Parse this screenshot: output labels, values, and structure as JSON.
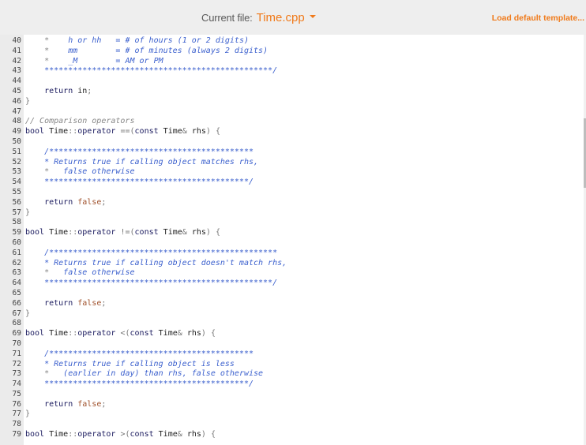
{
  "header": {
    "current_file_label": "Current file:",
    "current_file_name": "Time.cpp",
    "load_template_label": "Load default template...",
    "accent_color": "#f07a1a"
  },
  "editor": {
    "lines": [
      {
        "n": "40",
        "tokens": [
          [
            "doc",
            "    "
          ],
          [
            "star",
            "*"
          ],
          [
            "doc",
            "    h or hh   = # of hours (1 or 2 digits)"
          ]
        ]
      },
      {
        "n": "41",
        "tokens": [
          [
            "doc",
            "    "
          ],
          [
            "star",
            "*"
          ],
          [
            "doc",
            "    mm        = # of minutes (always 2 digits)"
          ]
        ]
      },
      {
        "n": "42",
        "tokens": [
          [
            "doc",
            "    "
          ],
          [
            "star",
            "*"
          ],
          [
            "doc",
            "    _M        = AM or PM"
          ]
        ]
      },
      {
        "n": "43",
        "tokens": [
          [
            "doc",
            "    ************************************************/"
          ]
        ]
      },
      {
        "n": "44",
        "tokens": []
      },
      {
        "n": "45",
        "tokens": [
          [
            "sp",
            "    "
          ],
          [
            "kw",
            "return"
          ],
          [
            "sp",
            " "
          ],
          [
            "id",
            "in"
          ],
          [
            "pn",
            ";"
          ]
        ]
      },
      {
        "n": "46",
        "tokens": [
          [
            "pn",
            "}"
          ]
        ]
      },
      {
        "n": "47",
        "tokens": []
      },
      {
        "n": "48",
        "tokens": [
          [
            "cm",
            "// Comparison operators"
          ]
        ]
      },
      {
        "n": "49",
        "tokens": [
          [
            "ty",
            "bool"
          ],
          [
            "sp",
            " "
          ],
          [
            "id",
            "Time"
          ],
          [
            "pn",
            "::"
          ],
          [
            "kw",
            "operator"
          ],
          [
            "sp",
            " "
          ],
          [
            "pn",
            "==("
          ],
          [
            "kw",
            "const"
          ],
          [
            "sp",
            " "
          ],
          [
            "id",
            "Time"
          ],
          [
            "pn",
            "&"
          ],
          [
            "sp",
            " "
          ],
          [
            "id",
            "rhs"
          ],
          [
            "pn",
            ")"
          ],
          [
            "sp",
            " "
          ],
          [
            "pn",
            "{"
          ]
        ]
      },
      {
        "n": "50",
        "tokens": []
      },
      {
        "n": "51",
        "tokens": [
          [
            "doc",
            "    /*******************************************"
          ]
        ]
      },
      {
        "n": "52",
        "tokens": [
          [
            "doc",
            "    * Returns true if calling object matches rhs,"
          ]
        ]
      },
      {
        "n": "53",
        "tokens": [
          [
            "doc",
            "    "
          ],
          [
            "star",
            "*"
          ],
          [
            "doc",
            "   false otherwise"
          ]
        ]
      },
      {
        "n": "54",
        "tokens": [
          [
            "doc",
            "    *******************************************/"
          ]
        ]
      },
      {
        "n": "55",
        "tokens": []
      },
      {
        "n": "56",
        "tokens": [
          [
            "sp",
            "    "
          ],
          [
            "kw",
            "return"
          ],
          [
            "sp",
            " "
          ],
          [
            "lit",
            "false"
          ],
          [
            "pn",
            ";"
          ]
        ]
      },
      {
        "n": "57",
        "tokens": [
          [
            "pn",
            "}"
          ]
        ]
      },
      {
        "n": "58",
        "tokens": []
      },
      {
        "n": "59",
        "tokens": [
          [
            "ty",
            "bool"
          ],
          [
            "sp",
            " "
          ],
          [
            "id",
            "Time"
          ],
          [
            "pn",
            "::"
          ],
          [
            "kw",
            "operator"
          ],
          [
            "sp",
            " "
          ],
          [
            "pn",
            "!=("
          ],
          [
            "kw",
            "const"
          ],
          [
            "sp",
            " "
          ],
          [
            "id",
            "Time"
          ],
          [
            "pn",
            "&"
          ],
          [
            "sp",
            " "
          ],
          [
            "id",
            "rhs"
          ],
          [
            "pn",
            ")"
          ],
          [
            "sp",
            " "
          ],
          [
            "pn",
            "{"
          ]
        ]
      },
      {
        "n": "60",
        "tokens": []
      },
      {
        "n": "61",
        "tokens": [
          [
            "doc",
            "    /************************************************"
          ]
        ]
      },
      {
        "n": "62",
        "tokens": [
          [
            "doc",
            "    * Returns true if calling object doesn't match rhs,"
          ]
        ]
      },
      {
        "n": "63",
        "tokens": [
          [
            "doc",
            "    "
          ],
          [
            "star",
            "*"
          ],
          [
            "doc",
            "   false otherwise"
          ]
        ]
      },
      {
        "n": "64",
        "tokens": [
          [
            "doc",
            "    ************************************************/"
          ]
        ]
      },
      {
        "n": "65",
        "tokens": []
      },
      {
        "n": "66",
        "tokens": [
          [
            "sp",
            "    "
          ],
          [
            "kw",
            "return"
          ],
          [
            "sp",
            " "
          ],
          [
            "lit",
            "false"
          ],
          [
            "pn",
            ";"
          ]
        ]
      },
      {
        "n": "67",
        "tokens": [
          [
            "pn",
            "}"
          ]
        ]
      },
      {
        "n": "68",
        "tokens": []
      },
      {
        "n": "69",
        "tokens": [
          [
            "ty",
            "bool"
          ],
          [
            "sp",
            " "
          ],
          [
            "id",
            "Time"
          ],
          [
            "pn",
            "::"
          ],
          [
            "kw",
            "operator"
          ],
          [
            "sp",
            " "
          ],
          [
            "pn",
            "<("
          ],
          [
            "kw",
            "const"
          ],
          [
            "sp",
            " "
          ],
          [
            "id",
            "Time"
          ],
          [
            "pn",
            "&"
          ],
          [
            "sp",
            " "
          ],
          [
            "id",
            "rhs"
          ],
          [
            "pn",
            ")"
          ],
          [
            "sp",
            " "
          ],
          [
            "pn",
            "{"
          ]
        ]
      },
      {
        "n": "70",
        "tokens": []
      },
      {
        "n": "71",
        "tokens": [
          [
            "doc",
            "    /*******************************************"
          ]
        ]
      },
      {
        "n": "72",
        "tokens": [
          [
            "doc",
            "    * Returns true if calling object is less"
          ]
        ]
      },
      {
        "n": "73",
        "tokens": [
          [
            "doc",
            "    "
          ],
          [
            "star",
            "*"
          ],
          [
            "doc",
            "   (earlier in day) than rhs, false otherwise"
          ]
        ]
      },
      {
        "n": "74",
        "tokens": [
          [
            "doc",
            "    *******************************************/"
          ]
        ]
      },
      {
        "n": "75",
        "tokens": []
      },
      {
        "n": "76",
        "tokens": [
          [
            "sp",
            "    "
          ],
          [
            "kw",
            "return"
          ],
          [
            "sp",
            " "
          ],
          [
            "lit",
            "false"
          ],
          [
            "pn",
            ";"
          ]
        ]
      },
      {
        "n": "77",
        "tokens": [
          [
            "pn",
            "}"
          ]
        ]
      },
      {
        "n": "78",
        "tokens": []
      },
      {
        "n": "79",
        "tokens": [
          [
            "ty",
            "bool"
          ],
          [
            "sp",
            " "
          ],
          [
            "id",
            "Time"
          ],
          [
            "pn",
            "::"
          ],
          [
            "kw",
            "operator"
          ],
          [
            "sp",
            " "
          ],
          [
            "pn",
            ">("
          ],
          [
            "kw",
            "const"
          ],
          [
            "sp",
            " "
          ],
          [
            "id",
            "Time"
          ],
          [
            "pn",
            "&"
          ],
          [
            "sp",
            " "
          ],
          [
            "id",
            "rhs"
          ],
          [
            "pn",
            ")"
          ],
          [
            "sp",
            " "
          ],
          [
            "pn",
            "{"
          ]
        ]
      }
    ]
  }
}
